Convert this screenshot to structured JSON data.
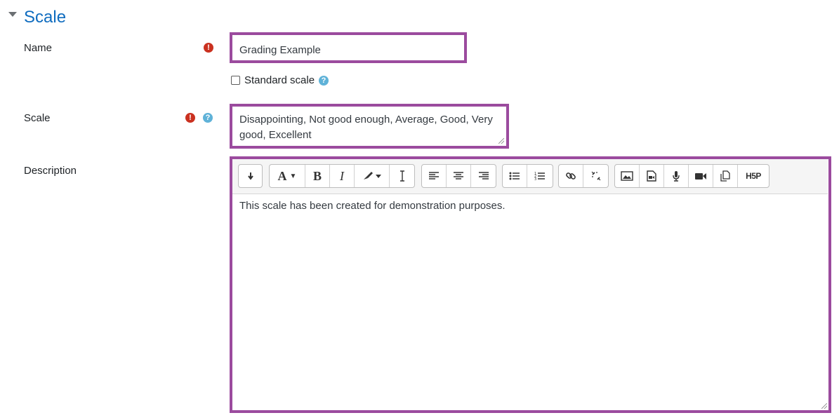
{
  "section": {
    "title": "Scale"
  },
  "name_field": {
    "label": "Name",
    "value": "Grading Example"
  },
  "standard_scale": {
    "label": "Standard scale",
    "checked": false
  },
  "scale_field": {
    "label": "Scale",
    "value_line1": "Disappointing, Not good enough, Average, Good, Very",
    "value_line2": "good, Excellent"
  },
  "description_field": {
    "label": "Description",
    "content": "This scale has been created for demonstration purposes."
  },
  "icons": {
    "required": "!",
    "help": "?"
  },
  "toolbar": {
    "buttons": [
      "show-more-icon",
      "font-style-icon",
      "bold-icon",
      "italic-icon",
      "text-color-icon",
      "clear-format-icon",
      "align-left-icon",
      "align-center-icon",
      "align-right-icon",
      "unordered-list-icon",
      "ordered-list-icon",
      "link-icon",
      "unlink-icon",
      "image-icon",
      "media-icon",
      "record-audio-icon",
      "record-video-icon",
      "manage-files-icon",
      "h5p-icon"
    ],
    "h5p_label": "H5P"
  },
  "colors": {
    "highlight": "#9b4b9e",
    "title": "#0f6cbf",
    "required": "#ca3120",
    "help": "#5fb2d8"
  }
}
